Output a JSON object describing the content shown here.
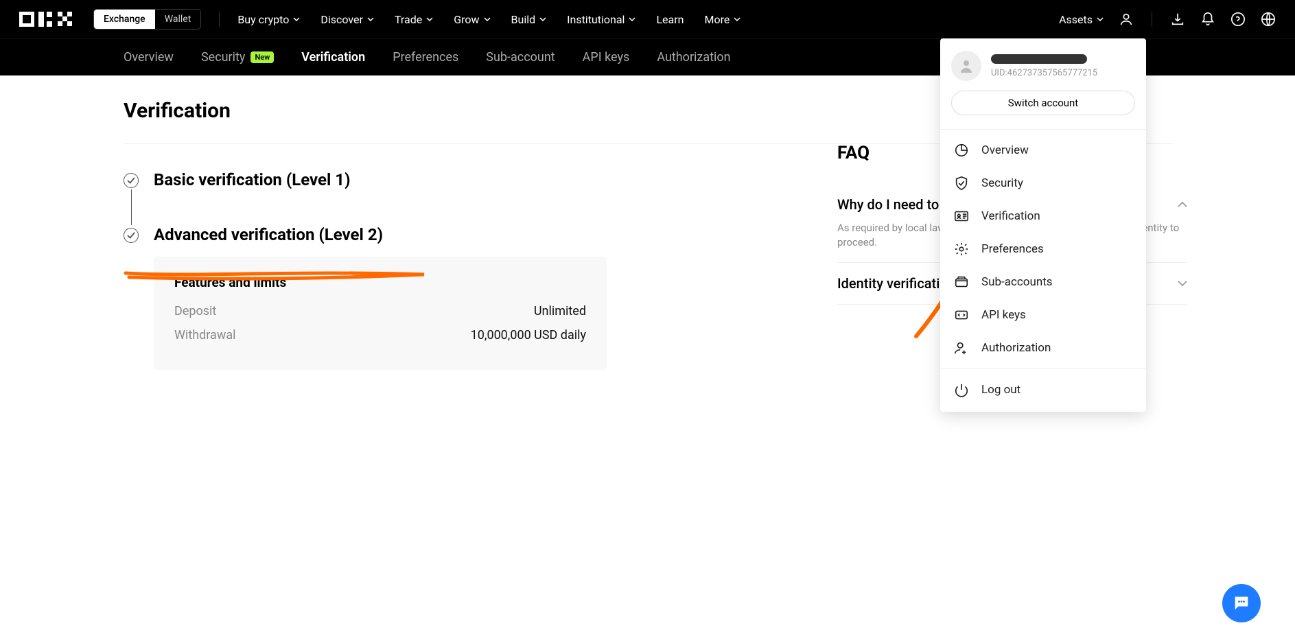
{
  "header": {
    "toggle": {
      "exchange": "Exchange",
      "wallet": "Wallet"
    },
    "nav": [
      "Buy crypto",
      "Discover",
      "Trade",
      "Grow",
      "Build",
      "Institutional",
      "Learn",
      "More"
    ],
    "nav_has_chev": [
      true,
      true,
      true,
      true,
      true,
      true,
      false,
      true
    ],
    "assets": "Assets"
  },
  "subnav": {
    "items": [
      "Overview",
      "Security",
      "Verification",
      "Preferences",
      "Sub-account",
      "API keys",
      "Authorization"
    ],
    "active_index": 2,
    "badge_index": 1,
    "badge_text": "New"
  },
  "page": {
    "title": "Verification",
    "level1": "Basic verification (Level 1)",
    "level2": "Advanced verification (Level 2)",
    "card": {
      "heading": "Features and limits",
      "rows": [
        {
          "label": "Deposit",
          "value": "Unlimited"
        },
        {
          "label": "Withdrawal",
          "value": "10,000,000 USD daily"
        }
      ]
    }
  },
  "faq": {
    "title": "FAQ",
    "items": [
      {
        "q": "Why do I need to verify my identity?",
        "a": "As required by local laws and regulations, you need to verify your identity to proceed.",
        "open": true
      },
      {
        "q": "Identity verification failed",
        "a": "",
        "open": false
      }
    ]
  },
  "dropdown": {
    "uid": "UID:462737357565777215",
    "switch": "Switch account",
    "items": [
      {
        "label": "Overview",
        "icon": "chart"
      },
      {
        "label": "Security",
        "icon": "shield"
      },
      {
        "label": "Verification",
        "icon": "idcard"
      },
      {
        "label": "Preferences",
        "icon": "gear"
      },
      {
        "label": "Sub-accounts",
        "icon": "wallet"
      },
      {
        "label": "API keys",
        "icon": "code"
      },
      {
        "label": "Authorization",
        "icon": "person"
      }
    ],
    "logout": "Log out"
  }
}
